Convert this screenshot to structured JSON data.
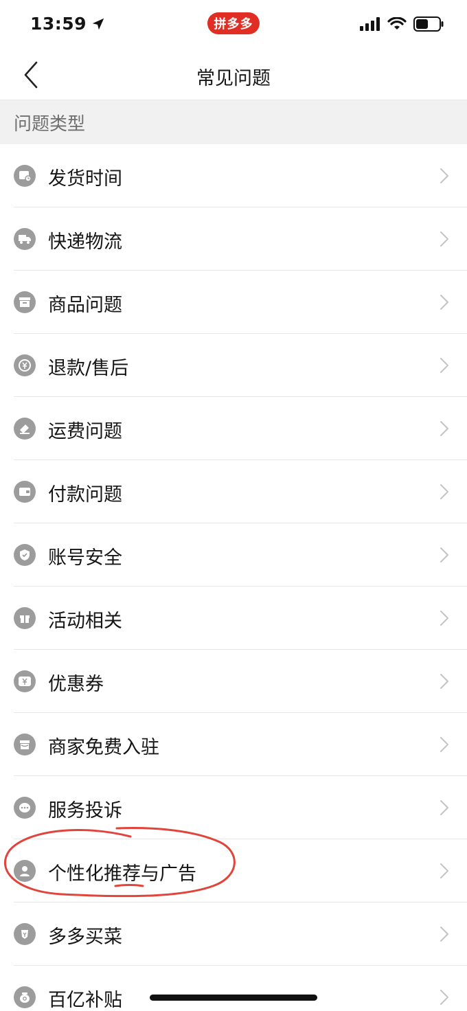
{
  "status_bar": {
    "time": "13:59",
    "app_badge": "拼多多"
  },
  "nav": {
    "title": "常见问题"
  },
  "section": {
    "title": "问题类型"
  },
  "items": [
    {
      "label": "发货时间",
      "icon": "calendar-clock-icon"
    },
    {
      "label": "快递物流",
      "icon": "truck-icon"
    },
    {
      "label": "商品问题",
      "icon": "box-icon"
    },
    {
      "label": "退款/售后",
      "icon": "refund-icon"
    },
    {
      "label": "运费问题",
      "icon": "shipping-fee-icon"
    },
    {
      "label": "付款问题",
      "icon": "wallet-icon"
    },
    {
      "label": "账号安全",
      "icon": "shield-icon"
    },
    {
      "label": "活动相关",
      "icon": "gift-icon"
    },
    {
      "label": "优惠券",
      "icon": "coupon-icon"
    },
    {
      "label": "商家免费入驻",
      "icon": "store-icon"
    },
    {
      "label": "服务投诉",
      "icon": "chat-bubble-icon"
    },
    {
      "label": "个性化推荐与广告",
      "icon": "user-icon"
    },
    {
      "label": "多多买菜",
      "icon": "vegetable-icon"
    },
    {
      "label": "百亿补贴",
      "icon": "subsidy-bag-icon"
    }
  ],
  "colors": {
    "brand": "#e02e24",
    "icon_gray": "#9c9c9c",
    "annotation": "#e0443a"
  }
}
